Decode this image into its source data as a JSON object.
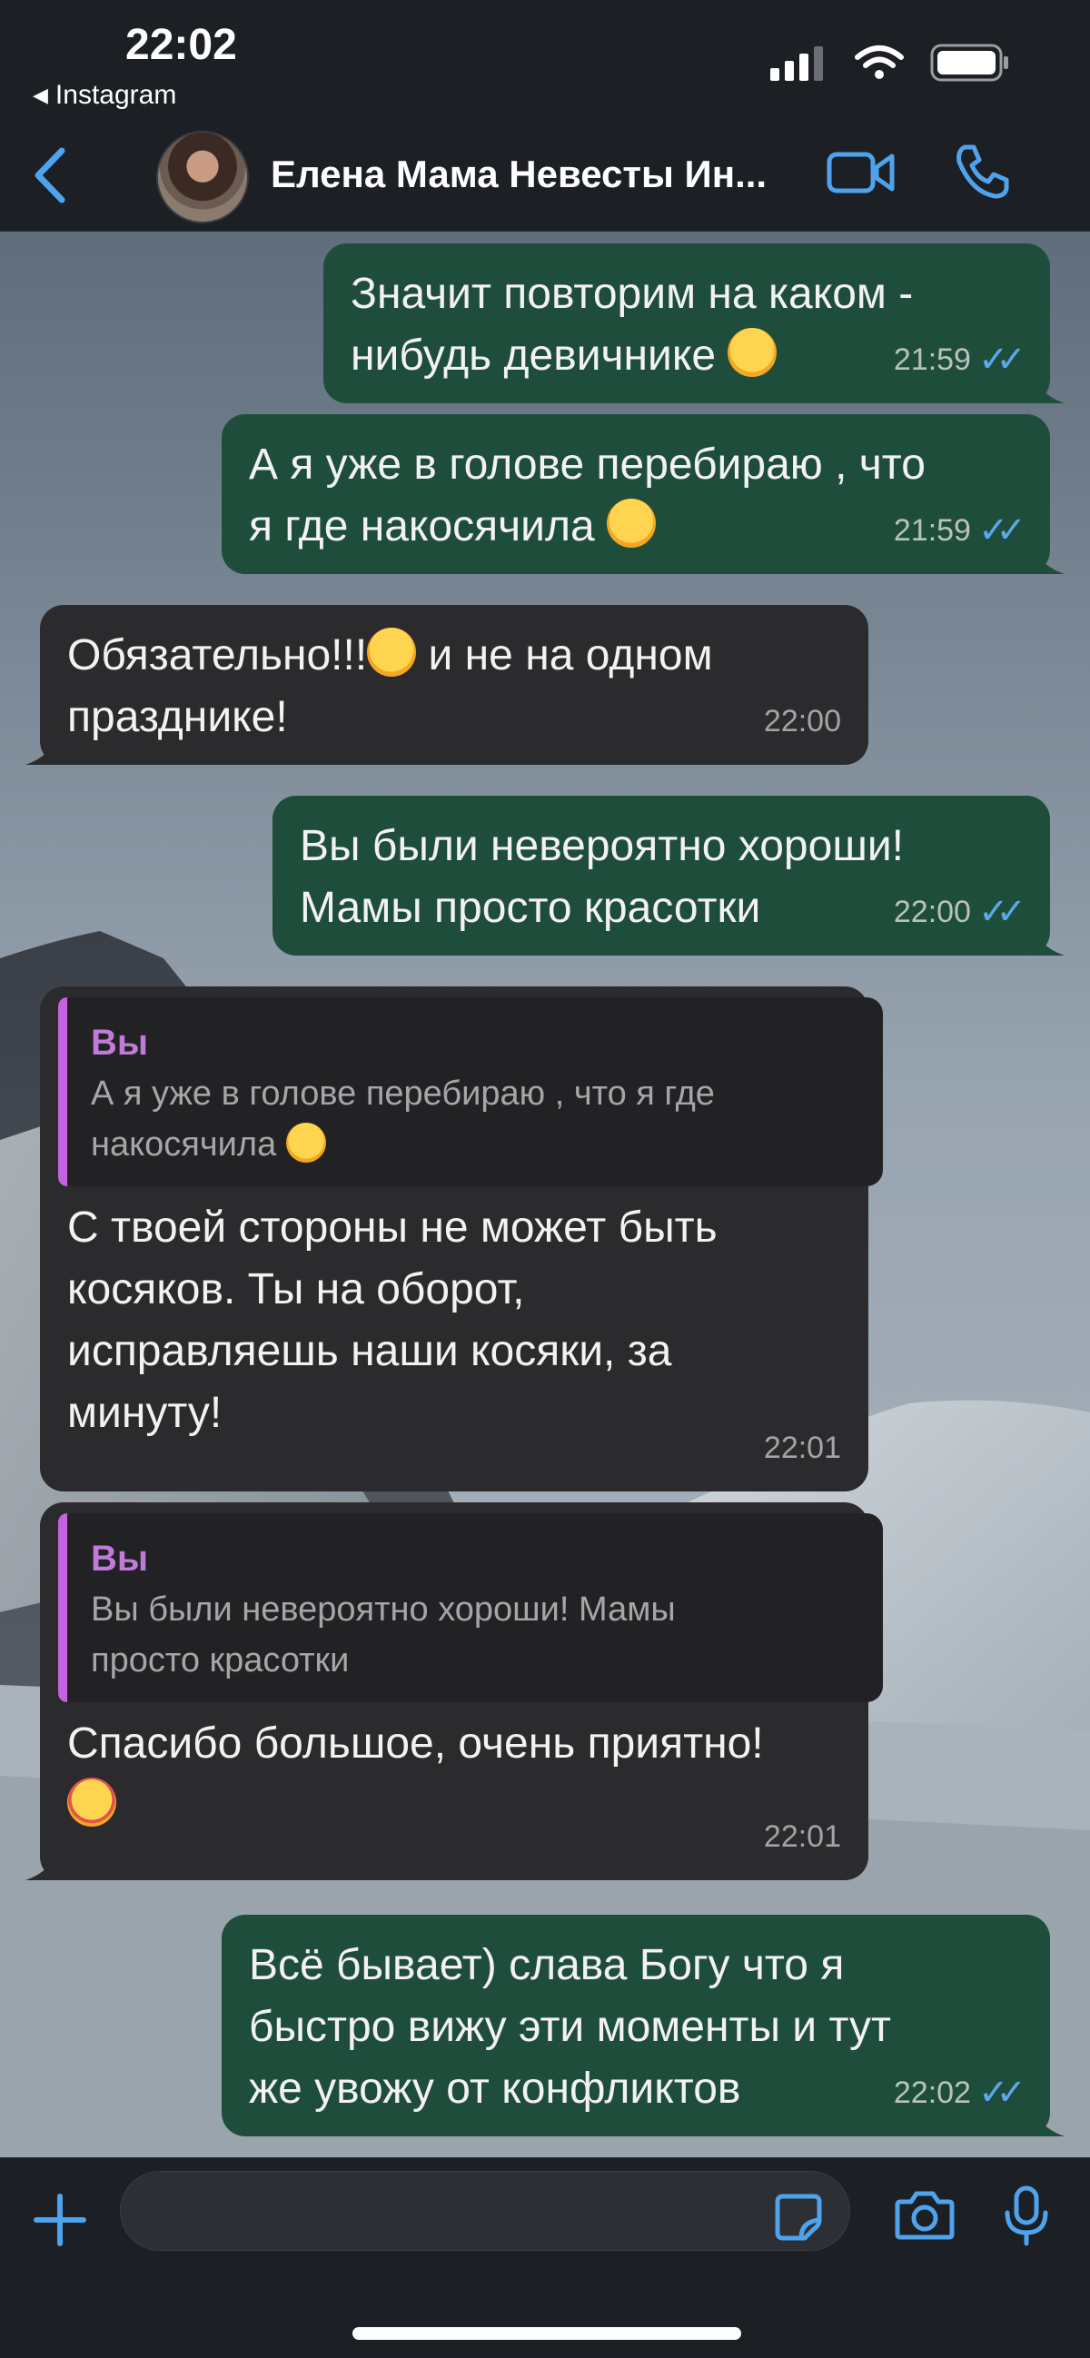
{
  "status_bar": {
    "time": "22:02",
    "back_app": "Instagram"
  },
  "header": {
    "contact_name": "Елена Мама Невесты Ин..."
  },
  "messages": [
    {
      "id": "m1",
      "direction": "outgoing",
      "text_lines": [
        "Значит повторим на каком -",
        "нибудь девичнике"
      ],
      "emoji": "joy",
      "time": "21:59",
      "read": true
    },
    {
      "id": "m2",
      "direction": "outgoing",
      "text_lines": [
        "А я уже в голове перебираю , что",
        "я где накосячила"
      ],
      "emoji": "joy",
      "time": "21:59",
      "read": true
    },
    {
      "id": "m3",
      "direction": "incoming",
      "text_lines": [
        "Обязательно!!!",
        " и не на одном",
        "празднике!"
      ],
      "emoji": "kiss",
      "time": "22:00"
    },
    {
      "id": "m4",
      "direction": "outgoing",
      "text_lines": [
        "Вы были невероятно хороши!",
        "Мамы просто красотки"
      ],
      "time": "22:00",
      "read": true
    },
    {
      "id": "m5",
      "direction": "incoming",
      "quote": {
        "author": "Вы",
        "text_lines": [
          "А я уже в голове перебираю , что я где",
          "накосячила"
        ]
      },
      "text_lines": [
        "С твоей стороны не может быть",
        "косяков. Ты на оборот,",
        "исправляешь наши косяки, за",
        "минуту!"
      ],
      "time": "22:01"
    },
    {
      "id": "m6",
      "direction": "incoming",
      "quote": {
        "author": "Вы",
        "text_lines": [
          "Вы были невероятно хороши! Мамы",
          "просто красотки"
        ]
      },
      "text_lines": [
        "Спасибо большое, очень приятно!"
      ],
      "emoji": "smiling_hearts",
      "time": "22:01"
    },
    {
      "id": "m7",
      "direction": "outgoing",
      "text_lines": [
        "Всё бывает) слава Богу что я",
        "быстро вижу эти моменты и тут",
        "же увожу от конфликтов"
      ],
      "time": "22:02",
      "read": true
    }
  ],
  "input": {
    "placeholder": ""
  },
  "icons": {
    "back": "chevron-left-icon",
    "video": "video-camera-icon",
    "call": "phone-icon",
    "plus": "plus-icon",
    "sticker": "sticker-icon",
    "camera": "camera-icon",
    "mic": "microphone-icon",
    "read_receipt": "double-check-icon"
  },
  "colors": {
    "accent": "#4fa3ec",
    "outgoing_bubble": "#1f4d3b",
    "incoming_bubble": "#2b2b2d",
    "quote_bar": "#c363df"
  }
}
